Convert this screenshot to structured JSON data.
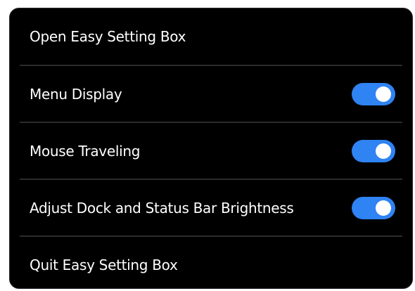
{
  "menu": {
    "items": [
      {
        "label": "Open Easy Setting Box"
      },
      {
        "label": "Menu Display",
        "toggle": true
      },
      {
        "label": "Mouse Traveling",
        "toggle": true
      },
      {
        "label": "Adjust Dock and Status Bar Brightness",
        "toggle": true
      },
      {
        "label": "Quit Easy Setting Box"
      }
    ]
  },
  "colors": {
    "background": "#000000",
    "toggle_on": "#2f83f3",
    "text": "#ffffff"
  }
}
